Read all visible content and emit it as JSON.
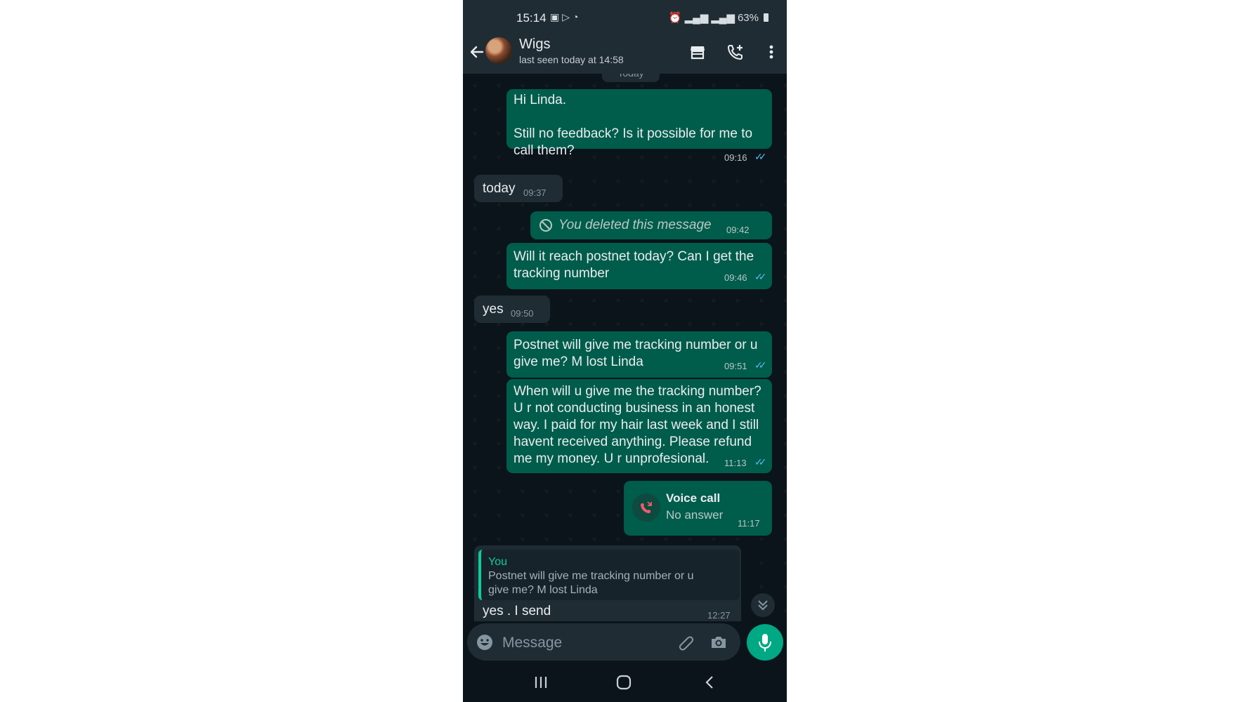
{
  "status_bar": {
    "time": "15:14",
    "left_icons": [
      "gallery-icon",
      "play-store-icon",
      "messenger-icon"
    ],
    "right_icons": [
      "alarm-icon",
      "signal-icon",
      "4g-signal-icon",
      "signal-icon"
    ],
    "battery": "63%"
  },
  "header": {
    "contact_name": "Wigs",
    "last_seen": "last seen today at 14:58",
    "icons": [
      "back-arrow-icon",
      "avatar",
      "store-icon",
      "add-call-icon",
      "more-options-icon"
    ]
  },
  "chat": {
    "date_chip": "Today",
    "messages": [
      {
        "type": "outgoing",
        "line1": "Hi Linda.",
        "line2": "Still no feedback? Is it possible for me to",
        "line3": "call them?",
        "time": "09:16",
        "ticks": "✓✓"
      },
      {
        "type": "incoming",
        "text": "today",
        "time": "09:37"
      },
      {
        "type": "outgoing-deleted",
        "text": "You deleted this message",
        "time": "09:42"
      },
      {
        "type": "outgoing",
        "line1": "Will it reach postnet today? Can I get the",
        "line2": "tracking number",
        "time": "09:46",
        "ticks": "✓✓"
      },
      {
        "type": "incoming",
        "text": "yes",
        "time": "09:50"
      },
      {
        "type": "outgoing",
        "line1": "Postnet will give me tracking number or u",
        "line2": "give me? M lost Linda",
        "time": "09:51",
        "ticks": "✓✓"
      },
      {
        "type": "outgoing",
        "lines": [
          "When will u give me the tracking number?",
          "U r not conducting business in an honest",
          "way. I paid for my hair last week and I still",
          "havent received anything. Please refund",
          "me my money. U r unprofesional."
        ],
        "time": "11:13",
        "ticks": "✓✓"
      },
      {
        "type": "call",
        "title": "Voice call",
        "subtitle": "No answer",
        "time": "11:17"
      },
      {
        "type": "incoming-reply",
        "quote_author": "You",
        "quote_line1": "Postnet will give me tracking number or u",
        "quote_line2": "give me? M lost Linda",
        "text": "yes . I send",
        "time": "12:27"
      }
    ]
  },
  "input": {
    "placeholder": "Message",
    "icons": [
      "emoji-icon",
      "attach-icon",
      "camera-icon",
      "mic-icon"
    ]
  },
  "nav_bar": {
    "icons": [
      "recent-apps-icon",
      "home-icon",
      "back-icon"
    ]
  },
  "colors": {
    "background": "#0b141a",
    "header": "#1f2c34",
    "outgoing_bubble": "#005c4b",
    "incoming_bubble": "#1f2c34",
    "accent": "#00a884",
    "read_ticks": "#53bdeb"
  }
}
